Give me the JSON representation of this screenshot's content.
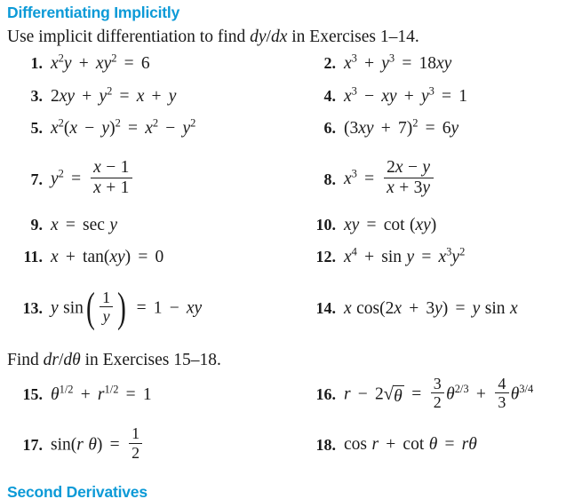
{
  "page": {
    "heading": "Differentiating Implicitly",
    "intro_prefix": "Use implicit differentiation to find ",
    "intro_math": "dy/dx",
    "intro_suffix": " in Exercises 1–14.",
    "find_prefix": "Find ",
    "find_math": "dr/dθ",
    "find_suffix": " in Exercises 15–18.",
    "bottom_heading": "Second Derivatives",
    "heading_color": "#0C9AD7",
    "text_color": "#1a1a1a",
    "background_color": "#ffffff"
  },
  "exercises": [
    {
      "number": "1.",
      "expression": "x²y + xy² = 6"
    },
    {
      "number": "2.",
      "expression": "x³ + y³ = 18xy"
    },
    {
      "number": "3.",
      "expression": "2xy + y² = x + y"
    },
    {
      "number": "4.",
      "expression": "x³ − xy + y³ = 1"
    },
    {
      "number": "5.",
      "expression": "x²(x − y)² = x² − y²"
    },
    {
      "number": "6.",
      "expression": "(3xy + 7)² = 6y"
    },
    {
      "number": "7.",
      "expression": "y² = (x − 1)/(x + 1)"
    },
    {
      "number": "8.",
      "expression": "x³ = (2x − y)/(x + 3y)"
    },
    {
      "number": "9.",
      "expression": "x = sec y"
    },
    {
      "number": "10.",
      "expression": "xy = cot (xy)"
    },
    {
      "number": "11.",
      "expression": "x + tan (xy) = 0"
    },
    {
      "number": "12.",
      "expression": "x⁴ + sin y = x³y²"
    },
    {
      "number": "13.",
      "expression": "y sin (1/y) = 1 − xy"
    },
    {
      "number": "14.",
      "expression": "x cos (2x + 3y) = y sin x"
    },
    {
      "number": "15.",
      "expression": "θ^(1/2) + r^(1/2) = 1"
    },
    {
      "number": "16.",
      "expression": "r − 2√θ = (3/2)θ^(2/3) + (4/3)θ^(3/4)"
    },
    {
      "number": "17.",
      "expression": "sin (rθ) = 1/2"
    },
    {
      "number": "18.",
      "expression": "cos r + cot θ = rθ"
    }
  ],
  "numbers": {
    "n1": "1.",
    "n2": "2.",
    "n3": "3.",
    "n4": "4.",
    "n5": "5.",
    "n6": "6.",
    "n7": "7.",
    "n8": "8.",
    "n9": "9.",
    "n10": "10.",
    "n11": "11.",
    "n12": "12.",
    "n13": "13.",
    "n14": "14.",
    "n15": "15.",
    "n16": "16.",
    "n17": "17.",
    "n18": "18."
  }
}
